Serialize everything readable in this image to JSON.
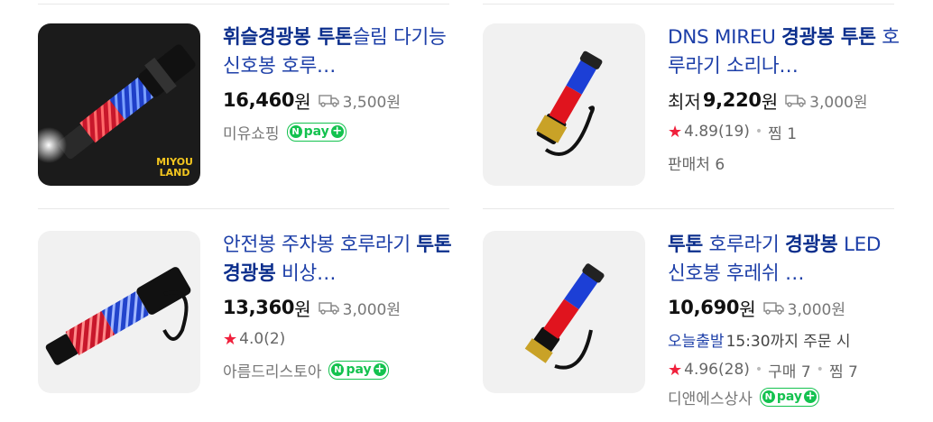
{
  "products": [
    {
      "title_parts": [
        {
          "text": "휘슬경광봉 ",
          "bold": true
        },
        {
          "text": "투톤",
          "bold": true
        },
        {
          "text": "슬림 다기능신호봉 호루…",
          "bold": false
        }
      ],
      "price_prefix": "",
      "price": "16,460",
      "won": "원",
      "shipping": "3,500원",
      "seller": "미유쇼핑",
      "npay": true,
      "image_label": "MIYOU\nLAND",
      "image_logo_line1": "MIYOU",
      "image_logo_line2": "LAND"
    },
    {
      "title_parts": [
        {
          "text": "DNS MIREU ",
          "bold": false
        },
        {
          "text": "경광봉 투톤",
          "bold": true
        },
        {
          "text": " 호루라기 소리나…",
          "bold": false
        }
      ],
      "price_prefix": "최저",
      "price": "9,220",
      "won": "원",
      "shipping": "3,000원",
      "rating": "4.89",
      "reviews": "(19)",
      "wish": "찜 1",
      "sellers": "판매처 6"
    },
    {
      "title_parts": [
        {
          "text": "안전봉 주차봉 호루라기 ",
          "bold": false
        },
        {
          "text": "투톤 경광봉",
          "bold": true
        },
        {
          "text": " 비상…",
          "bold": false
        }
      ],
      "price_prefix": "",
      "price": "13,360",
      "won": "원",
      "shipping": "3,000원",
      "rating": "4.0",
      "reviews": "(2)",
      "seller": "아름드리스토아",
      "npay": true
    },
    {
      "title_parts": [
        {
          "text": "투톤",
          "bold": true
        },
        {
          "text": " 호루라기 ",
          "bold": false
        },
        {
          "text": "경광봉",
          "bold": true
        },
        {
          "text": " LED 신호봉 후레쉬 …",
          "bold": false
        }
      ],
      "price_prefix": "",
      "price": "10,690",
      "won": "원",
      "shipping": "3,000원",
      "delivery_badge": "오늘출발",
      "delivery_text": "15:30까지 주문 시",
      "rating": "4.96",
      "reviews": "(28)",
      "purchases": "구매 7",
      "wish": "찜 7",
      "seller": "디앤에스상사",
      "npay": true
    }
  ],
  "npay_label": "pay",
  "npay_n": "N",
  "npay_plus": "+",
  "star_glyph": "★",
  "colors": {
    "title": "#1d3fa8",
    "npay": "#14c24f",
    "star": "#f0203c"
  }
}
